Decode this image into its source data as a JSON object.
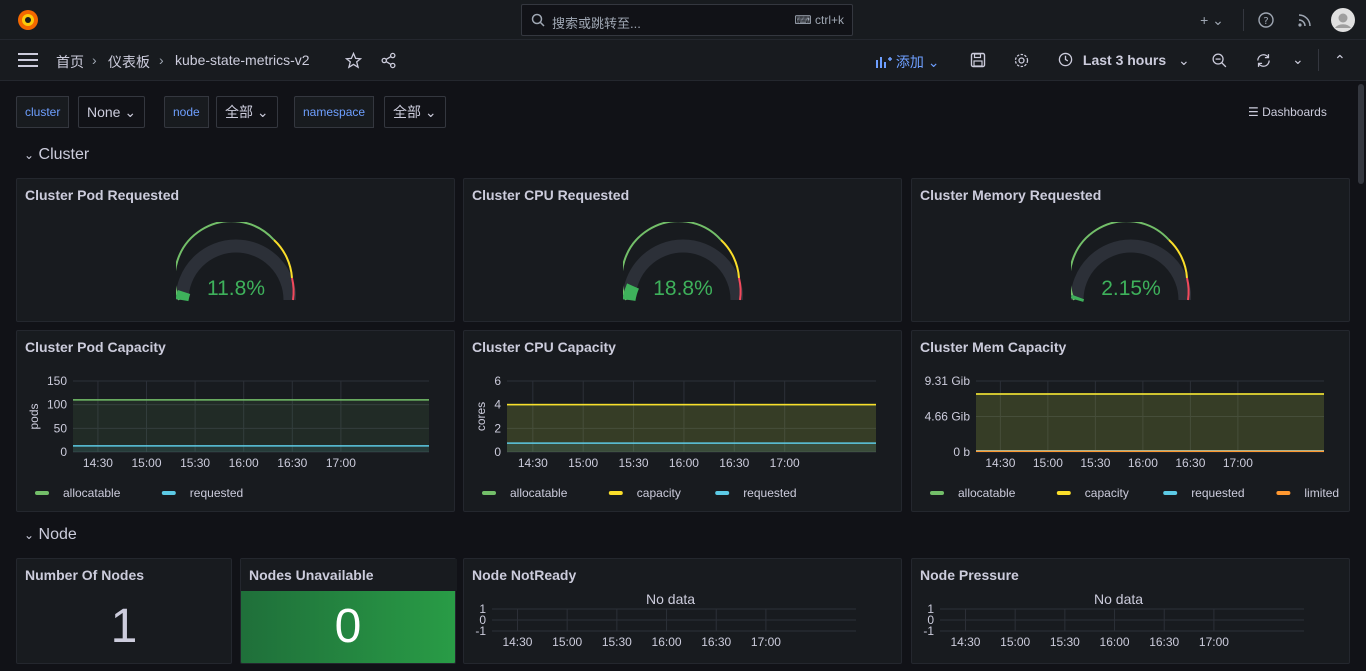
{
  "topbar": {
    "search_placeholder": "搜索或跳转至...",
    "search_shortcut": "ctrl+k",
    "add_icon": "plus-icon",
    "help_icon": "help-icon",
    "news_icon": "rss-icon"
  },
  "nav": {
    "breadcrumb_home": "首页",
    "breadcrumb_dashboards": "仪表板",
    "breadcrumb_current": "kube-state-metrics-v2",
    "add_label": "添加",
    "time_range": "Last 3 hours"
  },
  "variables": {
    "cluster_label": "cluster",
    "cluster_value": "None",
    "node_label": "node",
    "node_value": "全部",
    "namespace_label": "namespace",
    "namespace_value": "全部",
    "dashboards_link": "Dashboards"
  },
  "rows": {
    "cluster": "Cluster",
    "node": "Node"
  },
  "panels": {
    "pod_requested": {
      "title": "Cluster Pod Requested",
      "value": "11.8%"
    },
    "cpu_requested": {
      "title": "Cluster CPU Requested",
      "value": "18.8%"
    },
    "mem_requested": {
      "title": "Cluster Memory Requested",
      "value": "2.15%"
    },
    "pod_capacity": {
      "title": "Cluster Pod Capacity",
      "ylabel": "pods",
      "yticks": [
        "150",
        "100",
        "50",
        "0"
      ],
      "legend": [
        "allocatable",
        "requested"
      ]
    },
    "cpu_capacity": {
      "title": "Cluster CPU Capacity",
      "ylabel": "cores",
      "yticks": [
        "6",
        "4",
        "2",
        "0"
      ],
      "legend": [
        "allocatable",
        "capacity",
        "requested"
      ]
    },
    "mem_capacity": {
      "title": "Cluster Mem Capacity",
      "yticks": [
        "9.31 Gib",
        "4.66 Gib",
        "0 b"
      ],
      "legend": [
        "allocatable",
        "capacity",
        "requested",
        "limited"
      ]
    },
    "xticks": [
      "14:30",
      "15:00",
      "15:30",
      "16:00",
      "16:30",
      "17:00"
    ],
    "num_nodes": {
      "title": "Number Of Nodes",
      "value": "1"
    },
    "nodes_unavailable": {
      "title": "Nodes Unavailable",
      "value": "0"
    },
    "node_notready": {
      "title": "Node NotReady",
      "nodata": "No data",
      "yticks": [
        "1",
        "0",
        "-1"
      ]
    },
    "node_pressure": {
      "title": "Node Pressure",
      "nodata": "No data",
      "yticks": [
        "1",
        "0",
        "-1"
      ]
    }
  },
  "colors": {
    "green": "#73bf69",
    "yellow": "#fade2a",
    "cyan": "#5ccae5",
    "orange": "#ff9830",
    "gauge_text": "#3eb15b",
    "stat_green": "#299c46"
  },
  "chart_data": [
    {
      "type": "line",
      "title": "Cluster Pod Capacity",
      "ylabel": "pods",
      "ylim": [
        0,
        150
      ],
      "x": [
        "14:30",
        "15:00",
        "15:30",
        "16:00",
        "16:30",
        "17:00"
      ],
      "series": [
        {
          "name": "allocatable",
          "values": [
            110,
            110,
            110,
            110,
            110,
            110
          ]
        },
        {
          "name": "requested",
          "values": [
            13,
            13,
            13,
            13,
            13,
            13
          ]
        }
      ]
    },
    {
      "type": "line",
      "title": "Cluster CPU Capacity",
      "ylabel": "cores",
      "ylim": [
        0,
        6
      ],
      "x": [
        "14:30",
        "15:00",
        "15:30",
        "16:00",
        "16:30",
        "17:00"
      ],
      "series": [
        {
          "name": "allocatable",
          "values": [
            4,
            4,
            4,
            4,
            4,
            4
          ]
        },
        {
          "name": "capacity",
          "values": [
            4,
            4,
            4,
            4,
            4,
            4
          ]
        },
        {
          "name": "requested",
          "values": [
            0.75,
            0.75,
            0.75,
            0.75,
            0.75,
            0.75
          ]
        }
      ]
    },
    {
      "type": "line",
      "title": "Cluster Mem Capacity",
      "ylim": [
        0,
        9.31
      ],
      "x": [
        "14:30",
        "15:00",
        "15:30",
        "16:00",
        "16:30",
        "17:00"
      ],
      "series": [
        {
          "name": "allocatable",
          "values": [
            7.6,
            7.6,
            7.6,
            7.6,
            7.6,
            7.6
          ]
        },
        {
          "name": "capacity",
          "values": [
            7.6,
            7.6,
            7.6,
            7.6,
            7.6,
            7.6
          ]
        },
        {
          "name": "requested",
          "values": [
            0.16,
            0.16,
            0.16,
            0.16,
            0.16,
            0.16
          ]
        },
        {
          "name": "limited",
          "values": [
            0.1,
            0.1,
            0.1,
            0.1,
            0.1,
            0.1
          ]
        }
      ]
    }
  ]
}
